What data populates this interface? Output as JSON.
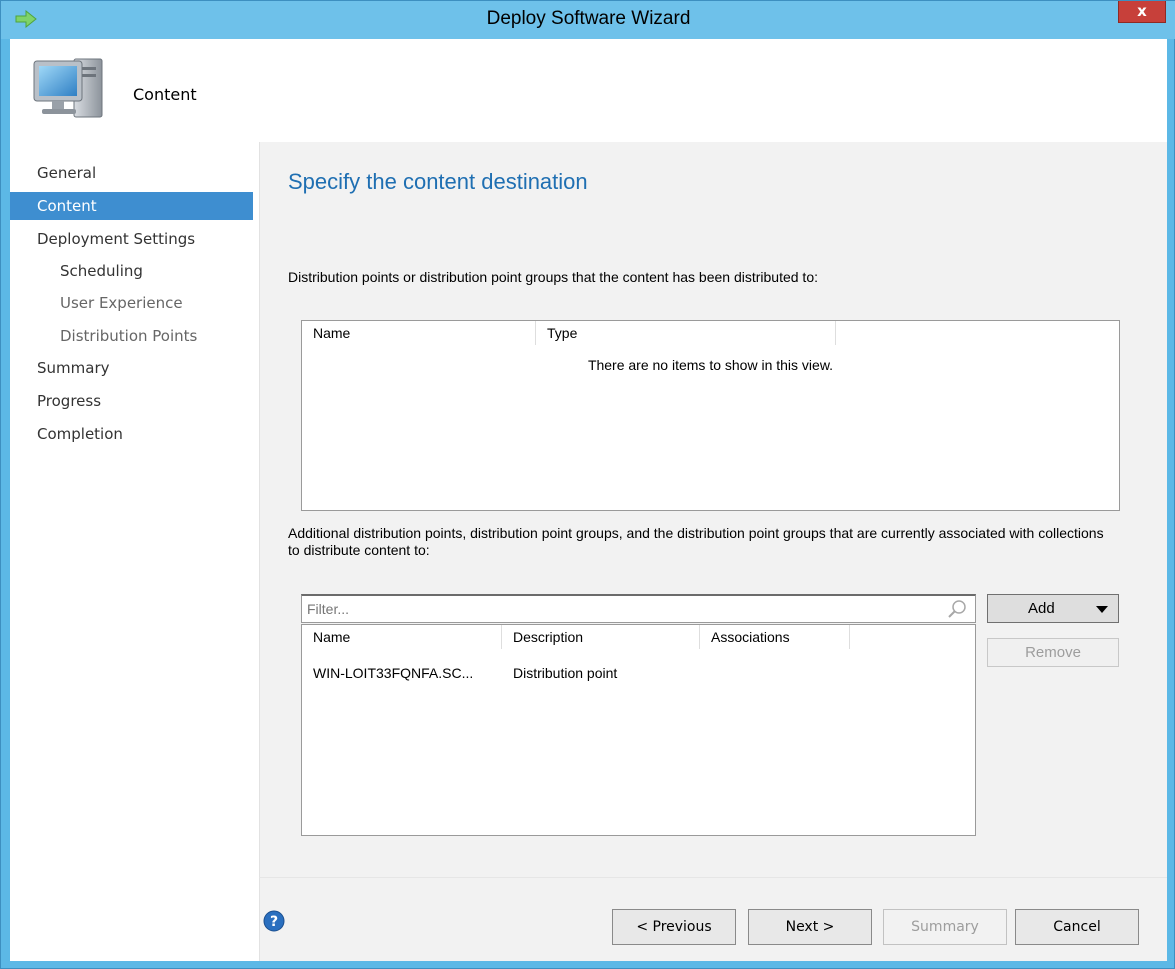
{
  "window": {
    "title": "Deploy Software Wizard",
    "close_label": "x"
  },
  "header": {
    "title": "Content"
  },
  "nav": {
    "items": [
      {
        "label": "General"
      },
      {
        "label": "Content"
      },
      {
        "label": "Deployment Settings"
      },
      {
        "label": "Scheduling"
      },
      {
        "label": "User Experience"
      },
      {
        "label": "Distribution Points"
      },
      {
        "label": "Summary"
      },
      {
        "label": "Progress"
      },
      {
        "label": "Completion"
      }
    ],
    "active_index": 1
  },
  "main": {
    "heading": "Specify the content destination",
    "distributed_label": "Distribution points or distribution point groups that the content has been distributed to:",
    "distributed_list": {
      "columns": [
        "Name",
        "Type"
      ],
      "empty_message": "There are no items to show in this view."
    },
    "additional_label": "Additional distribution points, distribution point groups, and the distribution point groups that are currently associated with collections to distribute content to:",
    "filter": {
      "placeholder": "Filter..."
    },
    "additional_list": {
      "columns": [
        "Name",
        "Description",
        "Associations"
      ],
      "rows": [
        {
          "name": "WIN-LOIT33FQNFA.SC...",
          "description": "Distribution point",
          "associations": ""
        }
      ]
    },
    "add_label": "Add",
    "remove_label": "Remove"
  },
  "footer": {
    "previous_label": "< Previous",
    "next_label": "Next >",
    "summary_label": "Summary",
    "cancel_label": "Cancel"
  },
  "colors": {
    "title_bar": "#6ec1ea",
    "active_nav": "#3e8ed0",
    "heading": "#1f6fb2",
    "close_button": "#c7403a"
  },
  "icons": {
    "title": "green-arrow-icon",
    "header": "computer-icon",
    "help": "help-icon",
    "filter": "search-icon"
  }
}
